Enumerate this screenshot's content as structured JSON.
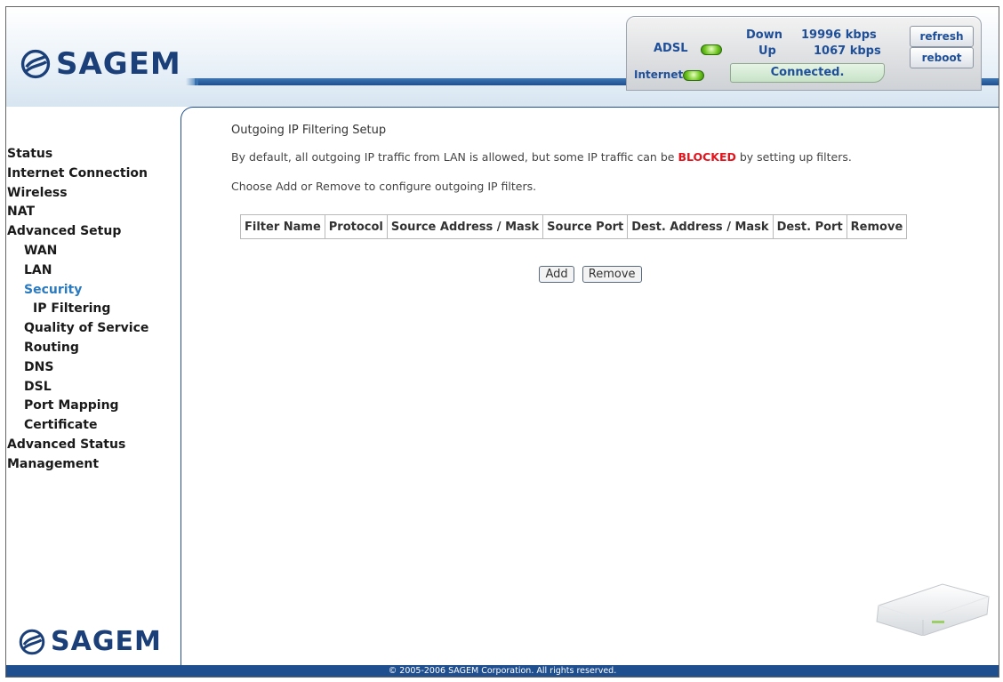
{
  "brand": {
    "name": "SAGEM"
  },
  "status": {
    "adsl_label": "ADSL",
    "internet_label": "Internet",
    "down_label": "Down",
    "up_label": "Up",
    "down_rate": "19996 kbps",
    "up_rate": "1067 kbps",
    "connection_state": "Connected.",
    "led_color": "#6dc41e",
    "refresh_label": "refresh",
    "reboot_label": "reboot"
  },
  "sidebar": {
    "items": [
      {
        "label": "Status",
        "level": 1
      },
      {
        "label": "Internet Connection",
        "level": 1
      },
      {
        "label": "Wireless",
        "level": 1
      },
      {
        "label": "NAT",
        "level": 1
      },
      {
        "label": "Advanced Setup",
        "level": 1
      },
      {
        "label": "WAN",
        "level": 2
      },
      {
        "label": "LAN",
        "level": 2
      },
      {
        "label": "Security",
        "level": 2,
        "active": true
      },
      {
        "label": "IP Filtering",
        "level": 3
      },
      {
        "label": "Quality of Service",
        "level": 2
      },
      {
        "label": "Routing",
        "level": 2
      },
      {
        "label": "DNS",
        "level": 2
      },
      {
        "label": "DSL",
        "level": 2
      },
      {
        "label": "Port Mapping",
        "level": 2
      },
      {
        "label": "Certificate",
        "level": 2
      },
      {
        "label": "Advanced Status",
        "level": 1
      },
      {
        "label": "Management",
        "level": 1
      }
    ],
    "active_color": "#2a7ac0"
  },
  "main": {
    "title": "Outgoing IP Filtering Setup",
    "desc1_pre": "By default, all outgoing IP traffic from LAN is allowed, but some IP traffic can be ",
    "desc1_em": "BLOCKED",
    "desc1_post": " by setting up filters.",
    "desc2": "Choose Add or Remove to configure outgoing IP filters.",
    "table": {
      "columns": [
        "Filter Name",
        "Protocol",
        "Source Address / Mask",
        "Source Port",
        "Dest. Address / Mask",
        "Dest. Port",
        "Remove"
      ],
      "rows": []
    },
    "add_label": "Add",
    "remove_label": "Remove",
    "blocked_color": "#e4131c"
  },
  "footer": {
    "copyright": "© 2005-2006 SAGEM Corporation. All rights reserved."
  },
  "theme": {
    "navy": "#1f4f8f",
    "label_blue": "#1e4f98"
  }
}
